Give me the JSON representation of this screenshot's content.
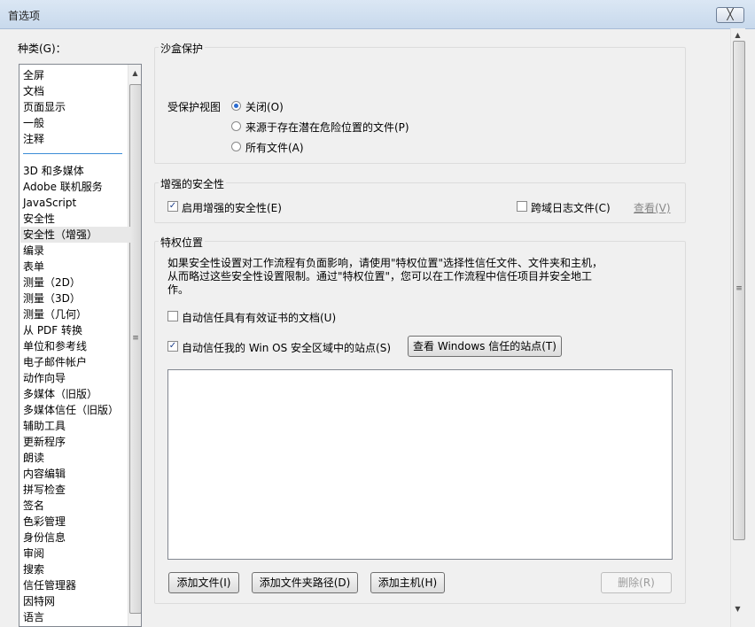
{
  "window": {
    "title": "首选项",
    "close_label": "╳"
  },
  "categories": {
    "label": "种类(G)：",
    "items": [
      "全屏",
      "文档",
      "页面显示",
      "一般",
      "注释",
      "3D 和多媒体",
      "Adobe 联机服务",
      "JavaScript",
      "安全性",
      "安全性（增强）",
      "编录",
      "表单",
      "测量（2D）",
      "测量（3D）",
      "测量（几何）",
      "从 PDF 转换",
      "单位和参考线",
      "电子邮件帐户",
      "动作向导",
      "多媒体（旧版）",
      "多媒体信任（旧版）",
      "辅助工具",
      "更新程序",
      "朗读",
      "内容编辑",
      "拼写检查",
      "签名",
      "色彩管理",
      "身份信息",
      "审阅",
      "搜索",
      "信任管理器",
      "因特网",
      "语言"
    ],
    "selected": "安全性（增强）"
  },
  "sandbox": {
    "title": "沙盒保护",
    "view_label": "受保护视图",
    "options": [
      "关闭(O)",
      "来源于存在潜在危险位置的文件(P)",
      "所有文件(A)"
    ],
    "selected_index": 0
  },
  "enhanced": {
    "title": "增强的安全性",
    "enable_label": "启用增强的安全性(E)",
    "enable_checked": true,
    "crossdomain_label": "跨域日志文件(C)",
    "crossdomain_checked": false,
    "view_link": "查看(V)"
  },
  "privileged": {
    "title": "特权位置",
    "description": "如果安全性设置对工作流程有负面影响，请使用\"特权位置\"选择性信任文件、文件夹和主机，从而略过这些安全性设置限制。通过\"特权位置\"，您可以在工作流程中信任项目并安全地工作。",
    "auto_trust_cert_label": "自动信任具有有效证书的文档(U)",
    "auto_trust_cert_checked": false,
    "auto_trust_win_label": "自动信任我的 Win OS 安全区域中的站点(S)",
    "auto_trust_win_checked": true,
    "view_windows_sites_label": "查看 Windows 信任的站点(T)",
    "add_file_label": "添加文件(I)",
    "add_folder_label": "添加文件夹路径(D)",
    "add_host_label": "添加主机(H)",
    "remove_label": "删除(R)"
  },
  "icons": {
    "check": "✓",
    "scroll_up": "▲",
    "scroll_down": "▼",
    "grip": "≡"
  }
}
